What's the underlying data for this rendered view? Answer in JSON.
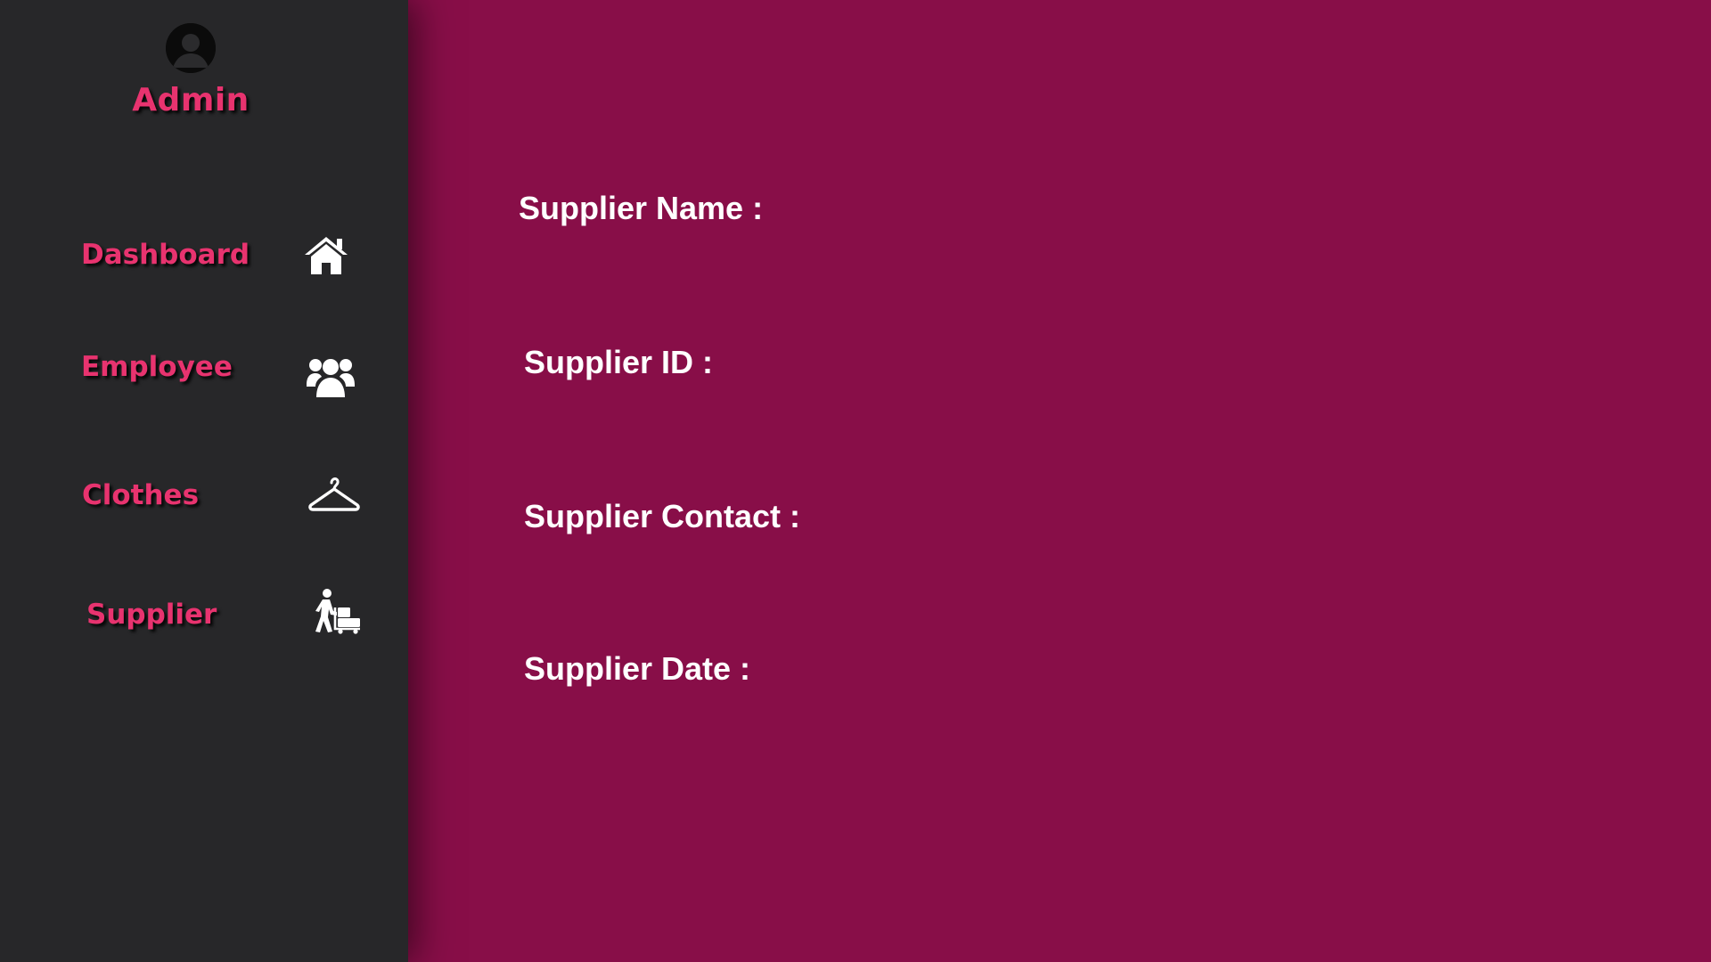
{
  "user": {
    "name": "Admin",
    "avatar_icon": "user-avatar-icon"
  },
  "sidebar": {
    "items": [
      {
        "label": "Dashboard",
        "icon": "home-icon"
      },
      {
        "label": "Employee",
        "icon": "users-group-icon"
      },
      {
        "label": "Clothes",
        "icon": "hanger-icon"
      },
      {
        "label": "Supplier",
        "icon": "supplier-delivery-icon"
      }
    ]
  },
  "form": {
    "fields": [
      {
        "label": "Supplier Name :"
      },
      {
        "label": "Supplier ID :"
      },
      {
        "label": "Supplier Contact :"
      },
      {
        "label": "Supplier Date :"
      }
    ]
  },
  "colors": {
    "sidebar_bg": "#272729",
    "main_bg": "#880e48",
    "accent": "#e8336f",
    "text_on_main": "#ffffff"
  }
}
